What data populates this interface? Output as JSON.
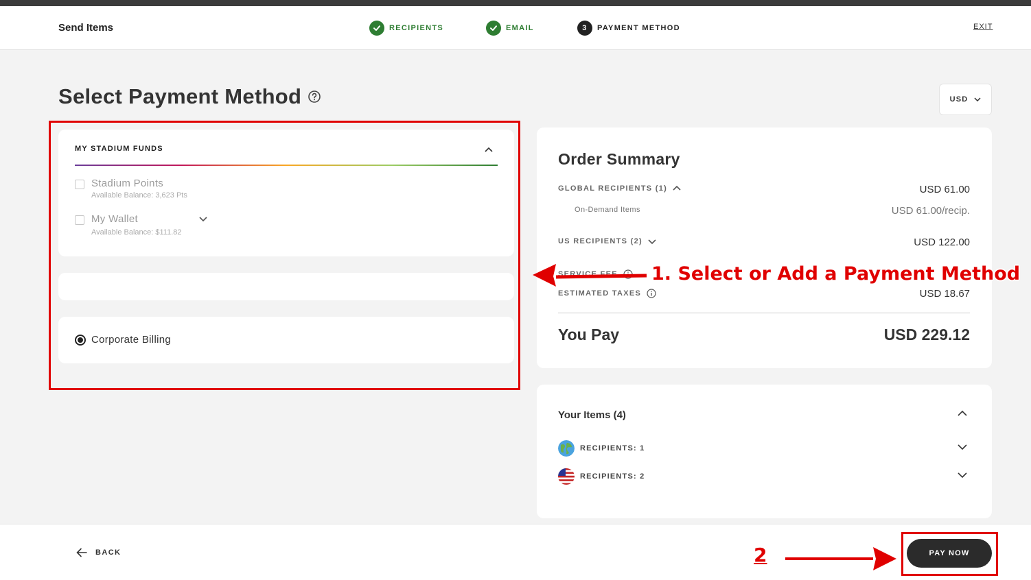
{
  "header": {
    "app_title": "Send Items",
    "steps": [
      {
        "label": "RECIPIENTS",
        "state": "done"
      },
      {
        "label": "EMAIL",
        "state": "done"
      },
      {
        "label": "PAYMENT METHOD",
        "state": "active",
        "number": "3"
      }
    ],
    "exit_label": "EXIT"
  },
  "page": {
    "title": "Select Payment Method",
    "help_icon": "question-circle-icon",
    "currency": "USD"
  },
  "funds": {
    "header": "MY STADIUM FUNDS",
    "options": [
      {
        "name": "Stadium Points",
        "balance": "Available Balance: 3,623 Pts",
        "checked": false
      },
      {
        "name": "My Wallet",
        "balance": "Available Balance: $111.82",
        "checked": false
      }
    ]
  },
  "billing": {
    "label": "Corporate Billing",
    "selected": true
  },
  "summary": {
    "title": "Order Summary",
    "global_label": "GLOBAL RECIPIENTS (1)",
    "global_value": "USD 61.00",
    "global_sub_label": "On-Demand Items",
    "global_sub_value": "USD 61.00/recip.",
    "us_label": "US RECIPIENTS (2)",
    "us_value": "USD 122.00",
    "fee_label": "SERVICE FEE",
    "taxes_label": "ESTIMATED TAXES",
    "taxes_value": "USD 18.67",
    "you_pay_label": "You Pay",
    "you_pay_value": "USD 229.12"
  },
  "items": {
    "title": "Your Items (4)",
    "rows": [
      {
        "label": "RECIPIENTS: 1",
        "icon": "globe-icon"
      },
      {
        "label": "RECIPIENTS: 2",
        "icon": "us-flag-icon"
      }
    ]
  },
  "footer": {
    "back_label": "BACK",
    "pay_label": "PAY NOW"
  },
  "annotations": {
    "step1": "1. Select or Add a Payment Method",
    "step2": "2",
    "color": "#e00000"
  },
  "colors": {
    "success_green": "#2e7d32",
    "dark": "#2b2b2b",
    "background": "#f3f3f3"
  }
}
